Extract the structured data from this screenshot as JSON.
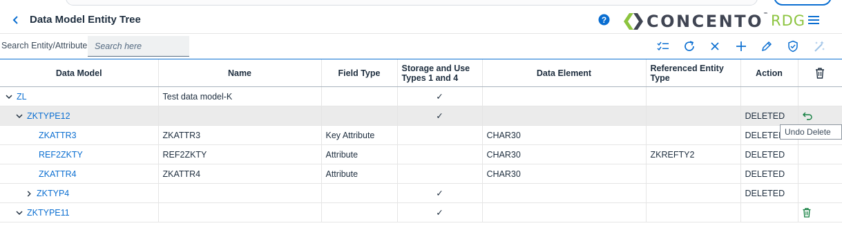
{
  "header": {
    "title": "Data Model Entity Tree"
  },
  "logo": {
    "wordmark": "CONCENTO",
    "tm": "™",
    "suffix": "RDG"
  },
  "search": {
    "label": "Search Entity/Attribute",
    "placeholder": "Search here"
  },
  "columns": [
    "Data Model",
    "Name",
    "Field Type",
    "Storage and Use Types 1 and 4",
    "Data Element",
    "Referenced Entity Type",
    "Action"
  ],
  "rows": [
    {
      "model": "ZL",
      "name": "Test data model-K",
      "field_type": "",
      "storage": "✓",
      "element": "",
      "ref": "",
      "action": ""
    },
    {
      "model": "ZKTYPE12",
      "name": "",
      "field_type": "",
      "storage": "✓",
      "element": "",
      "ref": "",
      "action": "DELETED"
    },
    {
      "model": "ZKATTR3",
      "name": "ZKATTR3",
      "field_type": "Key Attribute",
      "storage": "",
      "element": "CHAR30",
      "ref": "",
      "action": "DELETED"
    },
    {
      "model": "REF2ZKTY",
      "name": "REF2ZKTY",
      "field_type": "Attribute",
      "storage": "",
      "element": "CHAR30",
      "ref": "ZKREFTY2",
      "action": "DELETED"
    },
    {
      "model": "ZKATTR4",
      "name": "ZKATTR4",
      "field_type": "Attribute",
      "storage": "",
      "element": "CHAR30",
      "ref": "",
      "action": "DELETED"
    },
    {
      "model": "ZKTYP4",
      "name": "",
      "field_type": "",
      "storage": "✓",
      "element": "",
      "ref": "",
      "action": "DELETED"
    },
    {
      "model": "ZKTYPE11",
      "name": "",
      "field_type": "",
      "storage": "✓",
      "element": "",
      "ref": "",
      "action": ""
    }
  ],
  "tooltip": "Undo Delete",
  "colors": {
    "accent": "#0a6ed1",
    "brand_green": "#8cc43f",
    "success": "#107e3e"
  }
}
